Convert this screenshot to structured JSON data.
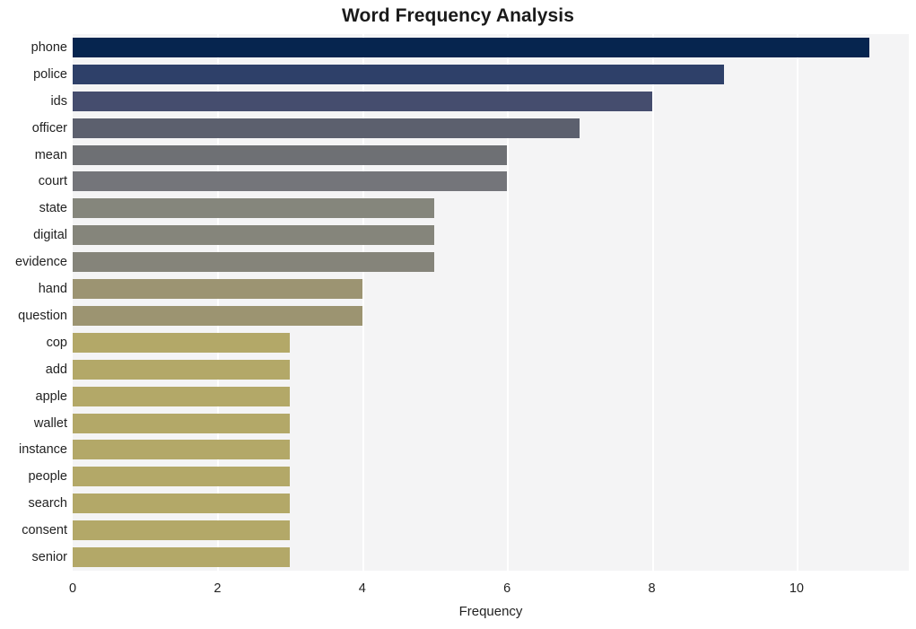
{
  "chart_data": {
    "type": "bar",
    "orientation": "horizontal",
    "title": "Word Frequency Analysis",
    "xlabel": "Frequency",
    "ylabel": "",
    "xlim": [
      0,
      11.55
    ],
    "xticks": [
      0,
      2,
      4,
      6,
      8,
      10
    ],
    "grid": true,
    "grid_axis": "x",
    "legend": null,
    "background": "#f4f4f5",
    "categories": [
      "phone",
      "police",
      "ids",
      "officer",
      "mean",
      "court",
      "state",
      "digital",
      "evidence",
      "hand",
      "question",
      "cop",
      "add",
      "apple",
      "wallet",
      "instance",
      "people",
      "search",
      "consent",
      "senior"
    ],
    "values": [
      11,
      9,
      8,
      7,
      6,
      6,
      5,
      5,
      5,
      4,
      4,
      3,
      3,
      3,
      3,
      3,
      3,
      3,
      3,
      3
    ],
    "bar_colors": [
      "#06254f",
      "#2e4069",
      "#454d6e",
      "#5c606e",
      "#6e7074",
      "#74757a",
      "#85867c",
      "#85857b",
      "#85847a",
      "#9c9472",
      "#9c9471",
      "#b3a868",
      "#b3a868",
      "#b3a868",
      "#b3a868",
      "#b3a868",
      "#b3a868",
      "#b3a868",
      "#b3a868",
      "#b3a868"
    ]
  }
}
